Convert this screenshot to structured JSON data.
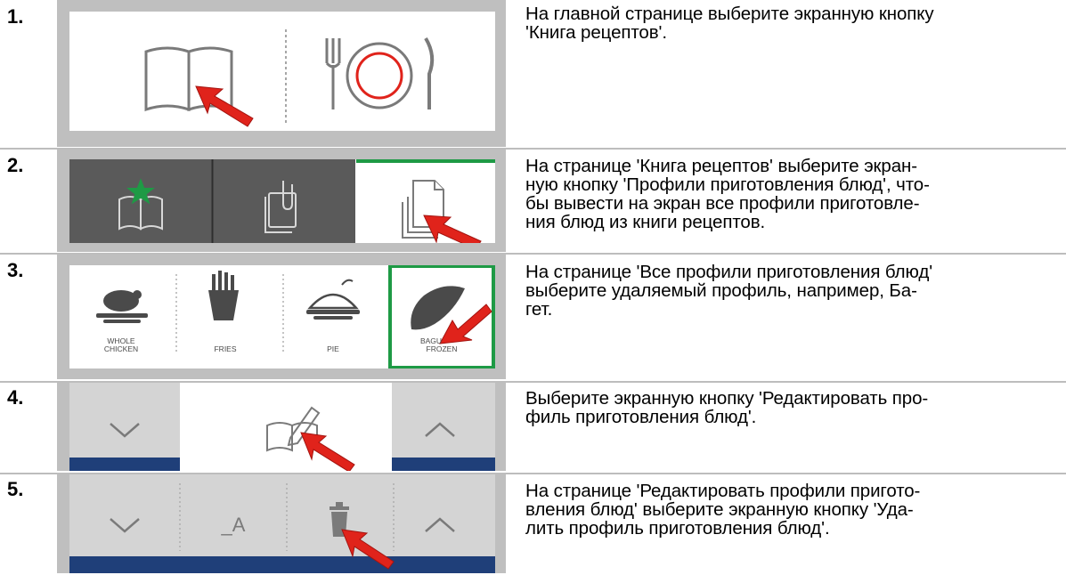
{
  "steps": [
    {
      "number": "1.",
      "lines": [
        "На главной странице выберите экранную кнопку",
        "'Книга рецептов'."
      ]
    },
    {
      "number": "2.",
      "lines": [
        "На странице 'Книга рецептов' выберите экран-",
        "ную кнопку 'Профили приготовления блюд', что-",
        "бы вывести на экран все профили приготовле-",
        "ния блюд из книги рецептов."
      ]
    },
    {
      "number": "3.",
      "lines": [
        "На странице 'Все профили приготовления блюд'",
        "выберите удаляемый профиль, например, Ба-",
        "гет."
      ],
      "tiles": {
        "whole_chicken_line1": "WHOLE",
        "whole_chicken_line2": "CHICKEN",
        "fries": "FRIES",
        "pie": "PIE",
        "baguette_line1": "BAGU",
        "baguette_line2": "FROZEN"
      }
    },
    {
      "number": "4.",
      "lines": [
        "Выберите экранную кнопку 'Редактировать про-",
        "филь приготовления блюд'."
      ]
    },
    {
      "number": "5.",
      "lines": [
        "На странице 'Редактировать профили пригото-",
        "вления блюд' выберите экранную кнопку 'Уда-",
        "лить профиль приготовления блюд'."
      ],
      "rename_label": "_A"
    }
  ],
  "colors": {
    "frame": "#bfbfbf",
    "arrow_red": "#e0231b",
    "accent_green": "#1e9a45",
    "dark_tab": "#5a5a5a",
    "nav_blue": "#1f3f79",
    "icon_gray": "#7a7a7a"
  },
  "icons": [
    "book-icon",
    "plate-fork-knife-icon",
    "bookmark-star-icon",
    "clip-document-icon",
    "documents-stack-icon",
    "chicken-icon",
    "fries-icon",
    "pie-icon",
    "baguette-icon",
    "chevron-down-icon",
    "chevron-up-icon",
    "book-edit-icon",
    "trash-icon",
    "pointer-arrow-icon"
  ]
}
